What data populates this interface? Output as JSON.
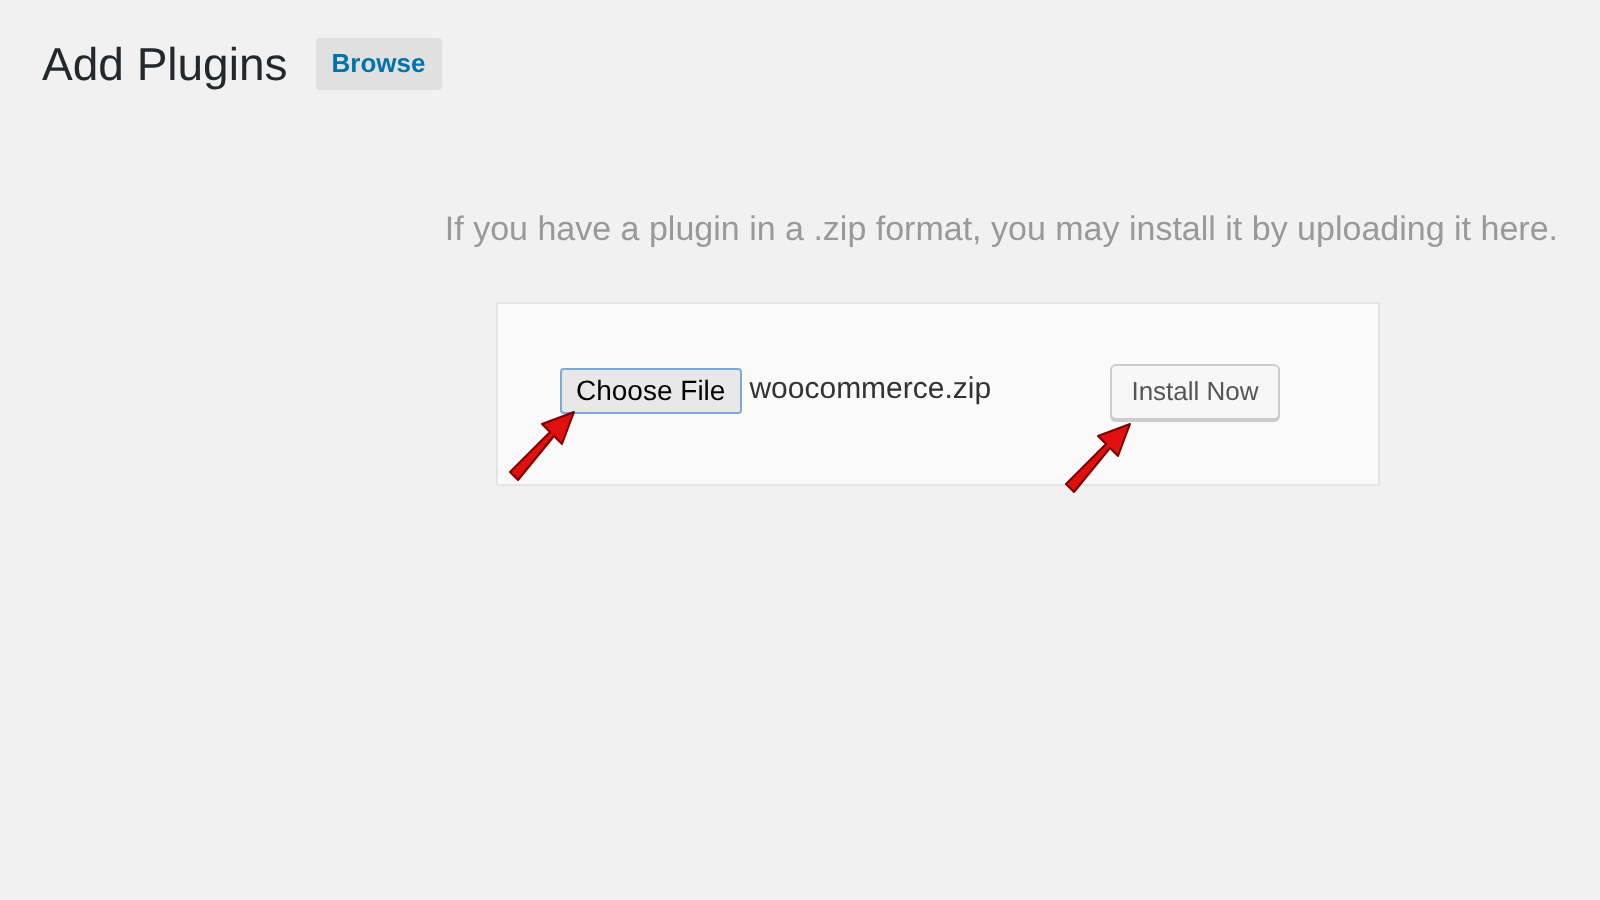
{
  "page": {
    "title": "Add Plugins",
    "browse_button": "Browse"
  },
  "description": "If you have a plugin in a .zip format, you may install it by uploading it here.",
  "upload_form": {
    "choose_button": "Choose File",
    "file_name": "woocommerce.zip",
    "install_button": "Install Now"
  }
}
